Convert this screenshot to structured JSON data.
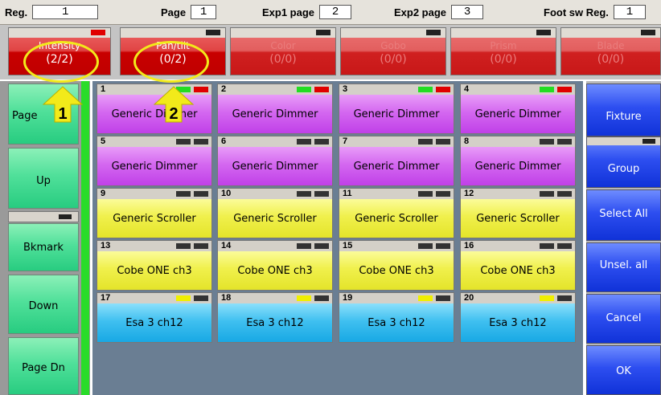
{
  "topbar": {
    "reg_label": "Reg.",
    "reg_value": "1",
    "page_label": "Page",
    "page_value": "1",
    "exp1_label": "Exp1 page",
    "exp1_value": "2",
    "exp2_label": "Exp2 page",
    "exp2_value": "3",
    "foot_label": "Foot sw Reg.",
    "foot_value": "1"
  },
  "preset_types": [
    {
      "name": "Intensity",
      "count": "(2/2)"
    },
    {
      "name": "Pan/tilt",
      "count": "(0/2)"
    },
    {
      "name": "Color",
      "count": "(0/0)"
    },
    {
      "name": "Gobo",
      "count": "(0/0)"
    },
    {
      "name": "Prism",
      "count": "(0/0)"
    },
    {
      "name": "Blade",
      "count": "(0/0)"
    }
  ],
  "left_buttons": {
    "page_up": "Page",
    "up": "Up",
    "bookmark": "Bkmark",
    "down": "Down",
    "page_down": "Page Dn"
  },
  "fixtures": [
    {
      "num": "1",
      "label": "Generic Dimmer"
    },
    {
      "num": "2",
      "label": "Generic Dimmer"
    },
    {
      "num": "3",
      "label": "Generic Dimmer"
    },
    {
      "num": "4",
      "label": "Generic Dimmer"
    },
    {
      "num": "5",
      "label": "Generic Dimmer"
    },
    {
      "num": "6",
      "label": "Generic Dimmer"
    },
    {
      "num": "7",
      "label": "Generic Dimmer"
    },
    {
      "num": "8",
      "label": "Generic Dimmer"
    },
    {
      "num": "9",
      "label": "Generic Scroller"
    },
    {
      "num": "10",
      "label": "Generic Scroller"
    },
    {
      "num": "11",
      "label": "Generic Scroller"
    },
    {
      "num": "12",
      "label": "Generic Scroller"
    },
    {
      "num": "13",
      "label": "Cobe ONE ch3"
    },
    {
      "num": "14",
      "label": "Cobe ONE ch3"
    },
    {
      "num": "15",
      "label": "Cobe ONE ch3"
    },
    {
      "num": "16",
      "label": "Cobe ONE ch3"
    },
    {
      "num": "17",
      "label": "Esa 3 ch12"
    },
    {
      "num": "18",
      "label": "Esa 3 ch12"
    },
    {
      "num": "19",
      "label": "Esa 3 ch12"
    },
    {
      "num": "20",
      "label": "Esa 3 ch12"
    }
  ],
  "right_buttons": {
    "fixture": "Fixture",
    "group": "Group",
    "select_all": "Select All",
    "unselect_all": "Unsel. all",
    "cancel": "Cancel",
    "ok": "OK"
  },
  "callouts": {
    "one": "1",
    "two": "2"
  },
  "colors": {
    "selected_indicator": "#e00000",
    "on_indicator": "#22dd22",
    "yellow_indicator": "#f0f000",
    "off_indicator": "#333333"
  }
}
